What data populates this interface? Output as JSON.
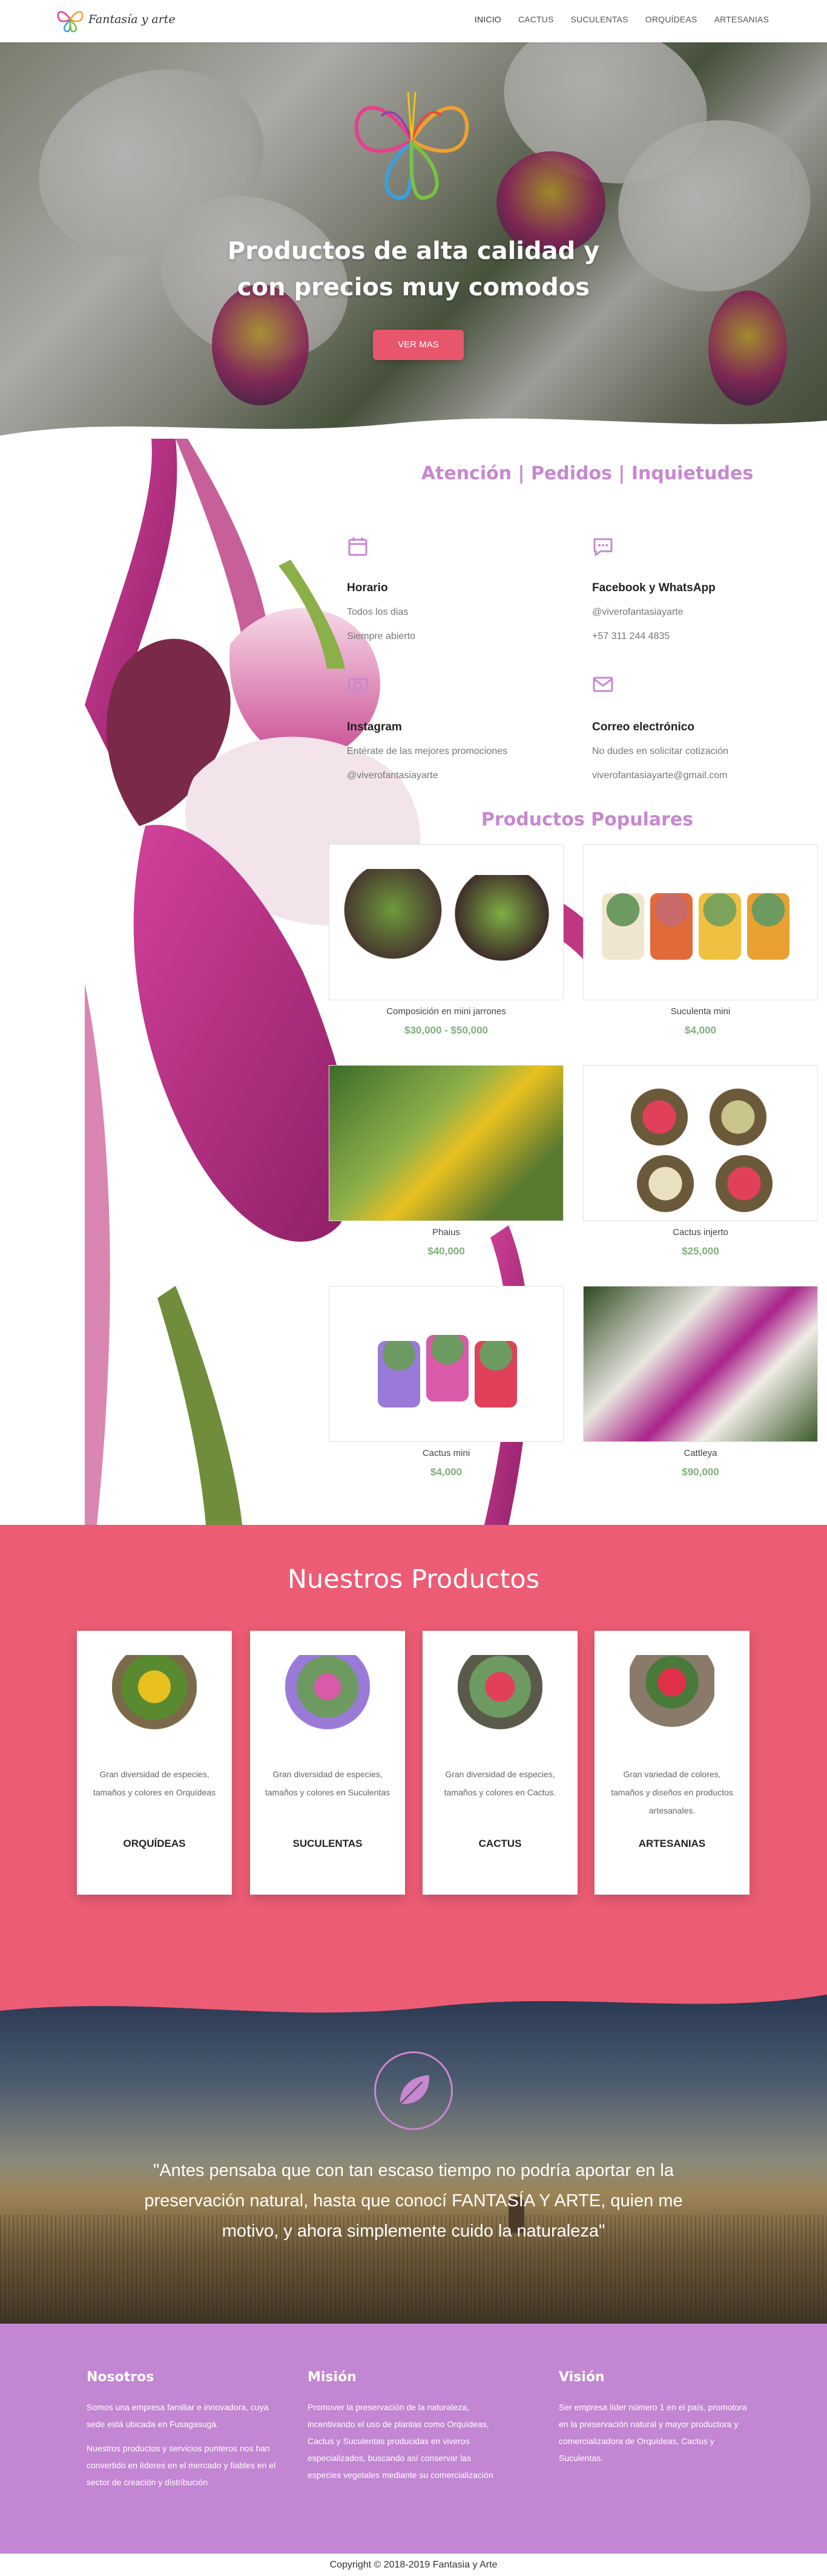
{
  "brand": {
    "name": "Fantasía y arte"
  },
  "nav": {
    "items": [
      {
        "label": "INICIO"
      },
      {
        "label": "CACTUS"
      },
      {
        "label": "SUCULENTAS"
      },
      {
        "label": "ORQUÍDEAS"
      },
      {
        "label": "ARTESANIAS"
      }
    ]
  },
  "hero": {
    "title_line1": "Productos de alta calidad y",
    "title_line2": "con precios muy comodos",
    "button_label": "VER MAS"
  },
  "info": {
    "heading": "Atención | Pedidos | Inquietudes",
    "blocks": [
      {
        "icon": "calendar-icon",
        "title": "Horario",
        "lines": [
          "Todos los dias",
          "Siempre abierto"
        ]
      },
      {
        "icon": "chat-icon",
        "title": "Facebook y WhatsApp",
        "lines": [
          "@viverofantasiayarte",
          "+57 311 244 4835"
        ]
      },
      {
        "icon": "camera-icon",
        "title": "Instagram",
        "lines": [
          "Entérate de las mejores promociones",
          "@viverofantasiayarte"
        ]
      },
      {
        "icon": "mail-icon",
        "title": "Correo electrónico",
        "lines": [
          "No dudes en solicitar cotización",
          "viverofantasiayarte@gmail.com"
        ]
      }
    ]
  },
  "popular": {
    "heading": "Productos Populares",
    "products": [
      {
        "name": "Composición en mini jarrones",
        "price": "$30,000 - $50,000"
      },
      {
        "name": "Suculenta mini",
        "price": "$4,000"
      },
      {
        "name": "Phaius",
        "price": "$40,000"
      },
      {
        "name": "Cactus injerto",
        "price": "$25,000"
      },
      {
        "name": "Cactus mini",
        "price": "$4,000"
      },
      {
        "name": "Cattleya",
        "price": "$90,000"
      }
    ]
  },
  "categories": {
    "heading": "Nuestros Productos",
    "items": [
      {
        "desc": "Gran diversidad de especies, tamaños y colores en Orquídeas",
        "name": "ORQUÍDEAS"
      },
      {
        "desc": "Gran diversidad de especies, tamaños y colores en Suculentas",
        "name": "SUCULENTAS"
      },
      {
        "desc": "Gran diversidad de especies, tamaños y colores en Cactus.",
        "name": "CACTUS"
      },
      {
        "desc": "Gran variedad de colores, tamaños y diseños en productos artesanales.",
        "name": "ARTESANIAS"
      }
    ]
  },
  "testimonial": {
    "quote": "\"Antes pensaba que con tan escaso tiempo no podría aportar en la preservación natural, hasta que conocí FANTASÍA Y ARTE, quien me motivo, y ahora simplemente cuido la naturaleza\""
  },
  "footer": {
    "columns": [
      {
        "title": "Nosotros",
        "paragraphs": [
          "Somos una empresa familiar e innovadora, cuya sede está ubicada en Fusagasugá.",
          "Nuestros productos y servicios punteros nos han convertido en líderes en el mercado y fiables en el sector de creación y distribución"
        ]
      },
      {
        "title": "Misión",
        "paragraphs": [
          "Promover la preservación de la naturaleza, incentivando el uso de plantas como Orquídeas, Cactus y Suculentas producidas en viveros especializados, buscando así conservar las especies vegetales mediante su comercialización"
        ]
      },
      {
        "title": "Visión",
        "paragraphs": [
          "Ser empresa líder número 1 en el país, promotora en la preservación natural y mayor productora y comercializadora de Orquídeas, Cactus y Suculentas."
        ]
      }
    ],
    "copyright": "Copyright © 2018-2019 Fantasia y Arte"
  },
  "colors": {
    "accent_pink": "#ec5c74",
    "accent_lilac": "#c788cf",
    "price_green": "#7fb07a"
  }
}
